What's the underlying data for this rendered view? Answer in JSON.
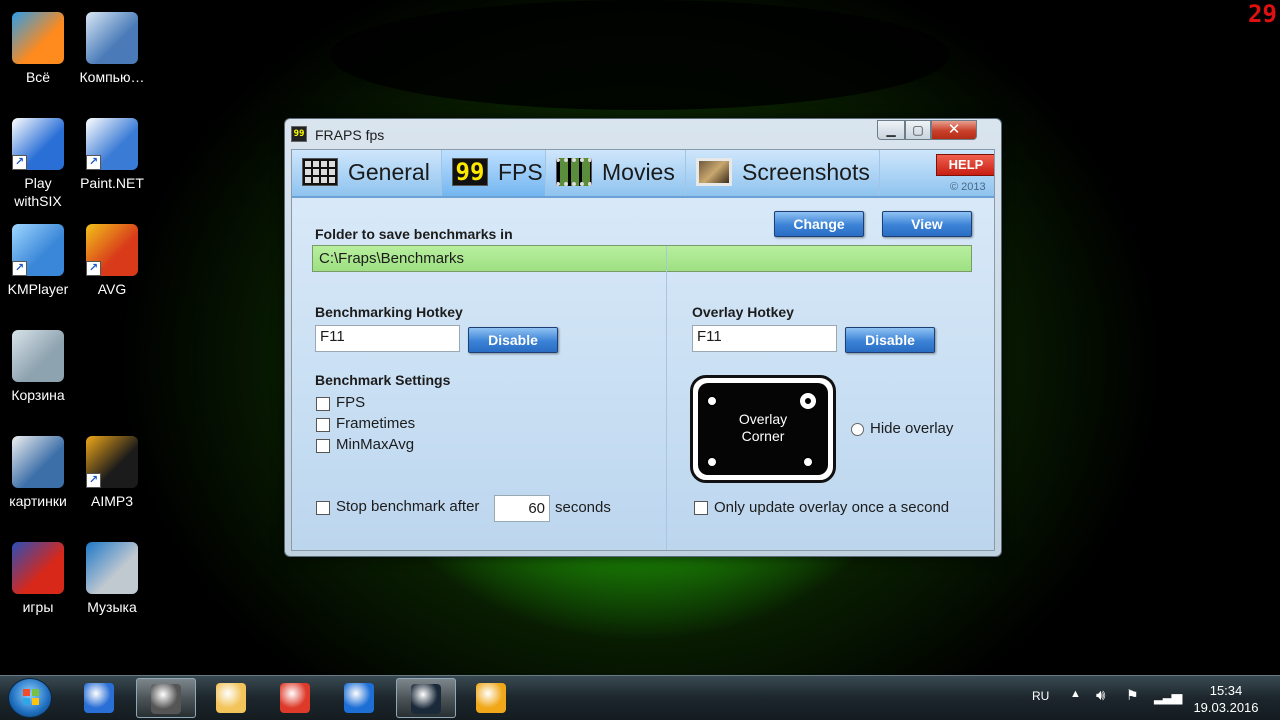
{
  "desktop": {
    "counter": "29",
    "icons": [
      {
        "label": "Всё",
        "color": "#ff8a1d",
        "accent": "#2c9de8",
        "shortcut": false
      },
      {
        "label": "Компью…",
        "color": "#4a7bb8",
        "accent": "#d9e7f5",
        "shortcut": false
      },
      {
        "label": "Play withSIX",
        "color": "#2a6fd6",
        "accent": "#ffffff",
        "shortcut": true
      },
      {
        "label": "Paint.NET",
        "color": "#3a7bd5",
        "accent": "#ffffff",
        "shortcut": true
      },
      {
        "label": "KMPlayer",
        "color": "#3a86d8",
        "accent": "#9fd7ff",
        "shortcut": true
      },
      {
        "label": "AVG",
        "color": "#d83a1a",
        "accent": "#f2c21a",
        "shortcut": true
      },
      {
        "label": "Корзина",
        "color": "#8ea3b0",
        "accent": "#d8e3ea",
        "shortcut": false
      },
      {
        "label": "картинки",
        "color": "#3c6fa8",
        "accent": "#f0f0f0",
        "shortcut": false
      },
      {
        "label": "AIMP3",
        "color": "#1b1b1b",
        "accent": "#f0a81a",
        "shortcut": true
      },
      {
        "label": "игры",
        "color": "#d8281a",
        "accent": "#2a4fb8",
        "shortcut": false
      },
      {
        "label": "Музыка",
        "color": "#c0c8d0",
        "accent": "#1d78c8",
        "shortcut": false
      }
    ]
  },
  "window": {
    "title": "FRAPS fps",
    "min_glyph": "▁",
    "max_glyph": "▢",
    "close_glyph": "✕",
    "tabs": [
      {
        "label": "General",
        "icon": "grid"
      },
      {
        "label": "FPS",
        "icon": "fps",
        "icon_text": "99"
      },
      {
        "label": "Movies",
        "icon": "film"
      },
      {
        "label": "Screenshots",
        "icon": "photo"
      }
    ],
    "help_label": "HELP",
    "copyright": "© 2013",
    "folder_label": "Folder to save benchmarks in",
    "change_label": "Change",
    "view_label": "View",
    "folder_path": "C:\\Fraps\\Benchmarks",
    "bench_hotkey_label": "Benchmarking Hotkey",
    "bench_hotkey_value": "F11",
    "bench_disable_label": "Disable",
    "overlay_hotkey_label": "Overlay Hotkey",
    "overlay_hotkey_value": "F11",
    "overlay_disable_label": "Disable",
    "settings_label": "Benchmark Settings",
    "opt_fps": "FPS",
    "opt_frametimes": "Frametimes",
    "opt_minmaxavg": "MinMaxAvg",
    "stop_label": "Stop benchmark after",
    "stop_value": "60",
    "seconds_label": "seconds",
    "overlay_corner_line1": "Overlay",
    "overlay_corner_line2": "Corner",
    "hide_overlay_label": "Hide overlay",
    "update_once_label": "Only update overlay once a second"
  },
  "taskbar": {
    "items": [
      {
        "name": "playwithsix",
        "color": "#2a6fd6",
        "active": false
      },
      {
        "name": "fraps",
        "color": "#555555",
        "active": true
      },
      {
        "name": "explorer",
        "color": "#f2c45a",
        "active": false
      },
      {
        "name": "chrome",
        "color": "#dd3a2a",
        "active": false
      },
      {
        "name": "garrysmod",
        "color": "#1d6fd6",
        "active": false
      },
      {
        "name": "steam",
        "color": "#1b2a3a",
        "active": true
      },
      {
        "name": "aimp",
        "color": "#f0a81a",
        "active": false
      }
    ],
    "lang": "RU",
    "time": "15:34",
    "date": "19.03.2016"
  }
}
